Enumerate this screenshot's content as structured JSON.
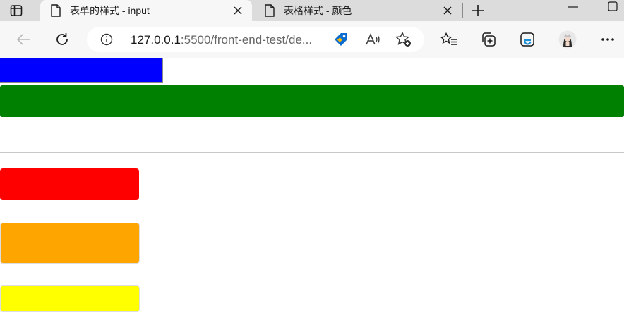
{
  "tabs": [
    {
      "title": "表单的样式 - input",
      "active": true
    },
    {
      "title": "表格样式 - 颜色",
      "active": false
    }
  ],
  "address_bar": {
    "url_host": "127.0.0.1",
    "url_rest": ":5500/front-end-test/de..."
  },
  "icons": {
    "tab_actions": "tab-actions-icon",
    "page": "page-icon",
    "close": "close-icon",
    "new_tab": "plus-icon",
    "minimize": "minimize-icon",
    "maximize": "maximize-icon",
    "back": "back-arrow-icon",
    "refresh": "refresh-icon",
    "info": "info-icon",
    "shopping_tag": "tag-icon",
    "read_aloud": "read-aloud-icon",
    "add_favorite": "star-add-icon",
    "favorites": "favorites-icon",
    "collections": "collections-icon",
    "ie_mode": "ie-mode-icon",
    "profile": "avatar",
    "more": "more-icon"
  },
  "page_inputs": [
    {
      "name": "blue-input",
      "color": "#0000ff"
    },
    {
      "name": "green-input",
      "color": "#008000"
    },
    {
      "name": "red-input",
      "color": "#ff0000"
    },
    {
      "name": "orange-input",
      "color": "#ffa500"
    },
    {
      "name": "yellow-input",
      "color": "#ffff00"
    }
  ],
  "colors": {
    "tabstrip_bg": "#dcdcdc",
    "toolbar_bg": "#f7f7f7",
    "tag_blue": "#0a6ccf",
    "ie_blue": "#1a8fd6"
  }
}
